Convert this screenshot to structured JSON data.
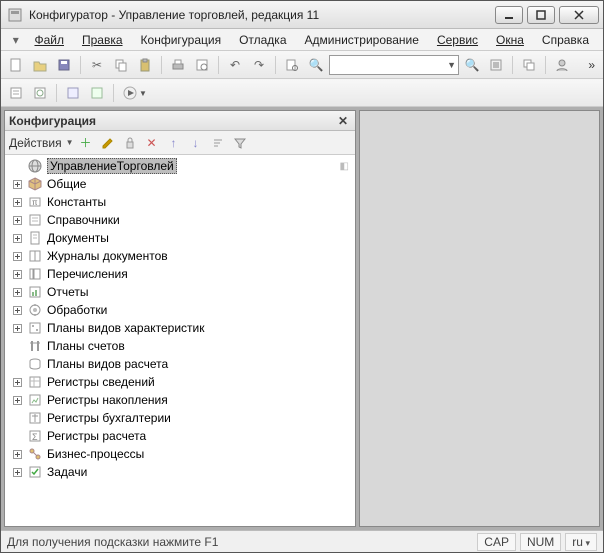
{
  "window": {
    "title": "Конфигуратор - Управление торговлей, редакция 11"
  },
  "menu": {
    "file": "Файл",
    "edit": "Правка",
    "config": "Конфигурация",
    "debug": "Отладка",
    "admin": "Администрирование",
    "service": "Сервис",
    "windows": "Окна",
    "help": "Справка"
  },
  "panel": {
    "title": "Конфигурация",
    "actions_label": "Действия"
  },
  "tree": {
    "root": "УправлениеТорговлей",
    "items": [
      {
        "label": "Общие",
        "icon": "cube-icon",
        "expandable": true
      },
      {
        "label": "Константы",
        "icon": "constants-icon",
        "expandable": true
      },
      {
        "label": "Справочники",
        "icon": "catalog-icon",
        "expandable": true
      },
      {
        "label": "Документы",
        "icon": "document-icon",
        "expandable": true
      },
      {
        "label": "Журналы документов",
        "icon": "journal-icon",
        "expandable": true
      },
      {
        "label": "Перечисления",
        "icon": "enum-icon",
        "expandable": true
      },
      {
        "label": "Отчеты",
        "icon": "report-icon",
        "expandable": true
      },
      {
        "label": "Обработки",
        "icon": "processing-icon",
        "expandable": true
      },
      {
        "label": "Планы видов характеристик",
        "icon": "plan-char-icon",
        "expandable": true
      },
      {
        "label": "Планы счетов",
        "icon": "plan-accounts-icon",
        "expandable": false
      },
      {
        "label": "Планы видов расчета",
        "icon": "plan-calc-icon",
        "expandable": false
      },
      {
        "label": "Регистры сведений",
        "icon": "reg-info-icon",
        "expandable": true
      },
      {
        "label": "Регистры накопления",
        "icon": "reg-accum-icon",
        "expandable": true
      },
      {
        "label": "Регистры бухгалтерии",
        "icon": "reg-accounting-icon",
        "expandable": false
      },
      {
        "label": "Регистры расчета",
        "icon": "reg-calc-icon",
        "expandable": false
      },
      {
        "label": "Бизнес-процессы",
        "icon": "bizproc-icon",
        "expandable": true
      },
      {
        "label": "Задачи",
        "icon": "tasks-icon",
        "expandable": true
      }
    ]
  },
  "status": {
    "hint": "Для получения подсказки нажмите F1",
    "cap": "CAP",
    "num": "NUM",
    "lang": "ru"
  }
}
